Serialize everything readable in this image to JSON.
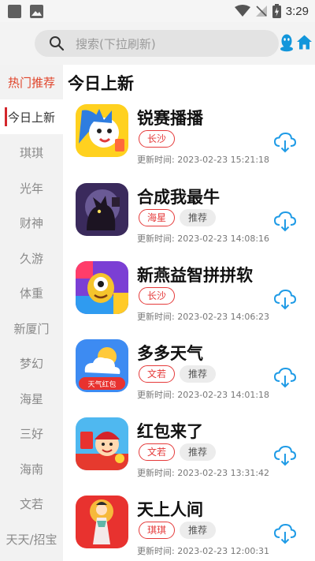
{
  "status": {
    "time": "3:29"
  },
  "search": {
    "placeholder": "搜索(下拉刷新)"
  },
  "sidebar": {
    "items": [
      {
        "label": "热门推荐"
      },
      {
        "label": "今日上新"
      },
      {
        "label": "琪琪"
      },
      {
        "label": "光年"
      },
      {
        "label": "财神"
      },
      {
        "label": "久游"
      },
      {
        "label": "体重"
      },
      {
        "label": "新厦门"
      },
      {
        "label": "梦幻"
      },
      {
        "label": "海星"
      },
      {
        "label": "三好"
      },
      {
        "label": "海南"
      },
      {
        "label": "文若"
      },
      {
        "label": "天天/招宝"
      }
    ]
  },
  "main": {
    "section_title": "今日上新",
    "update_prefix": "更新时间:",
    "apps": [
      {
        "name": "锐赛播播",
        "tags": [
          "长沙"
        ],
        "updated": "2023-02-23 15:21:18"
      },
      {
        "name": "合成我最牛",
        "tags": [
          "海星",
          "推荐"
        ],
        "updated": "2023-02-23 14:08:16"
      },
      {
        "name": "新燕益智拼拼软",
        "tags": [
          "长沙"
        ],
        "updated": "2023-02-23 14:06:23"
      },
      {
        "name": "多多天气",
        "tags": [
          "文若",
          "推荐"
        ],
        "updated": "2023-02-23 14:01:18",
        "icon_text": "天气红包"
      },
      {
        "name": "红包来了",
        "tags": [
          "文若",
          "推荐"
        ],
        "updated": "2023-02-23 13:31:42"
      },
      {
        "name": "天上人间",
        "tags": [
          "琪琪",
          "推荐"
        ],
        "updated": "2023-02-23 12:00:31"
      }
    ]
  },
  "colors": {
    "accent_red": "#e53a3a",
    "download_blue": "#1f9be6",
    "hot_orange": "#e0442a"
  }
}
